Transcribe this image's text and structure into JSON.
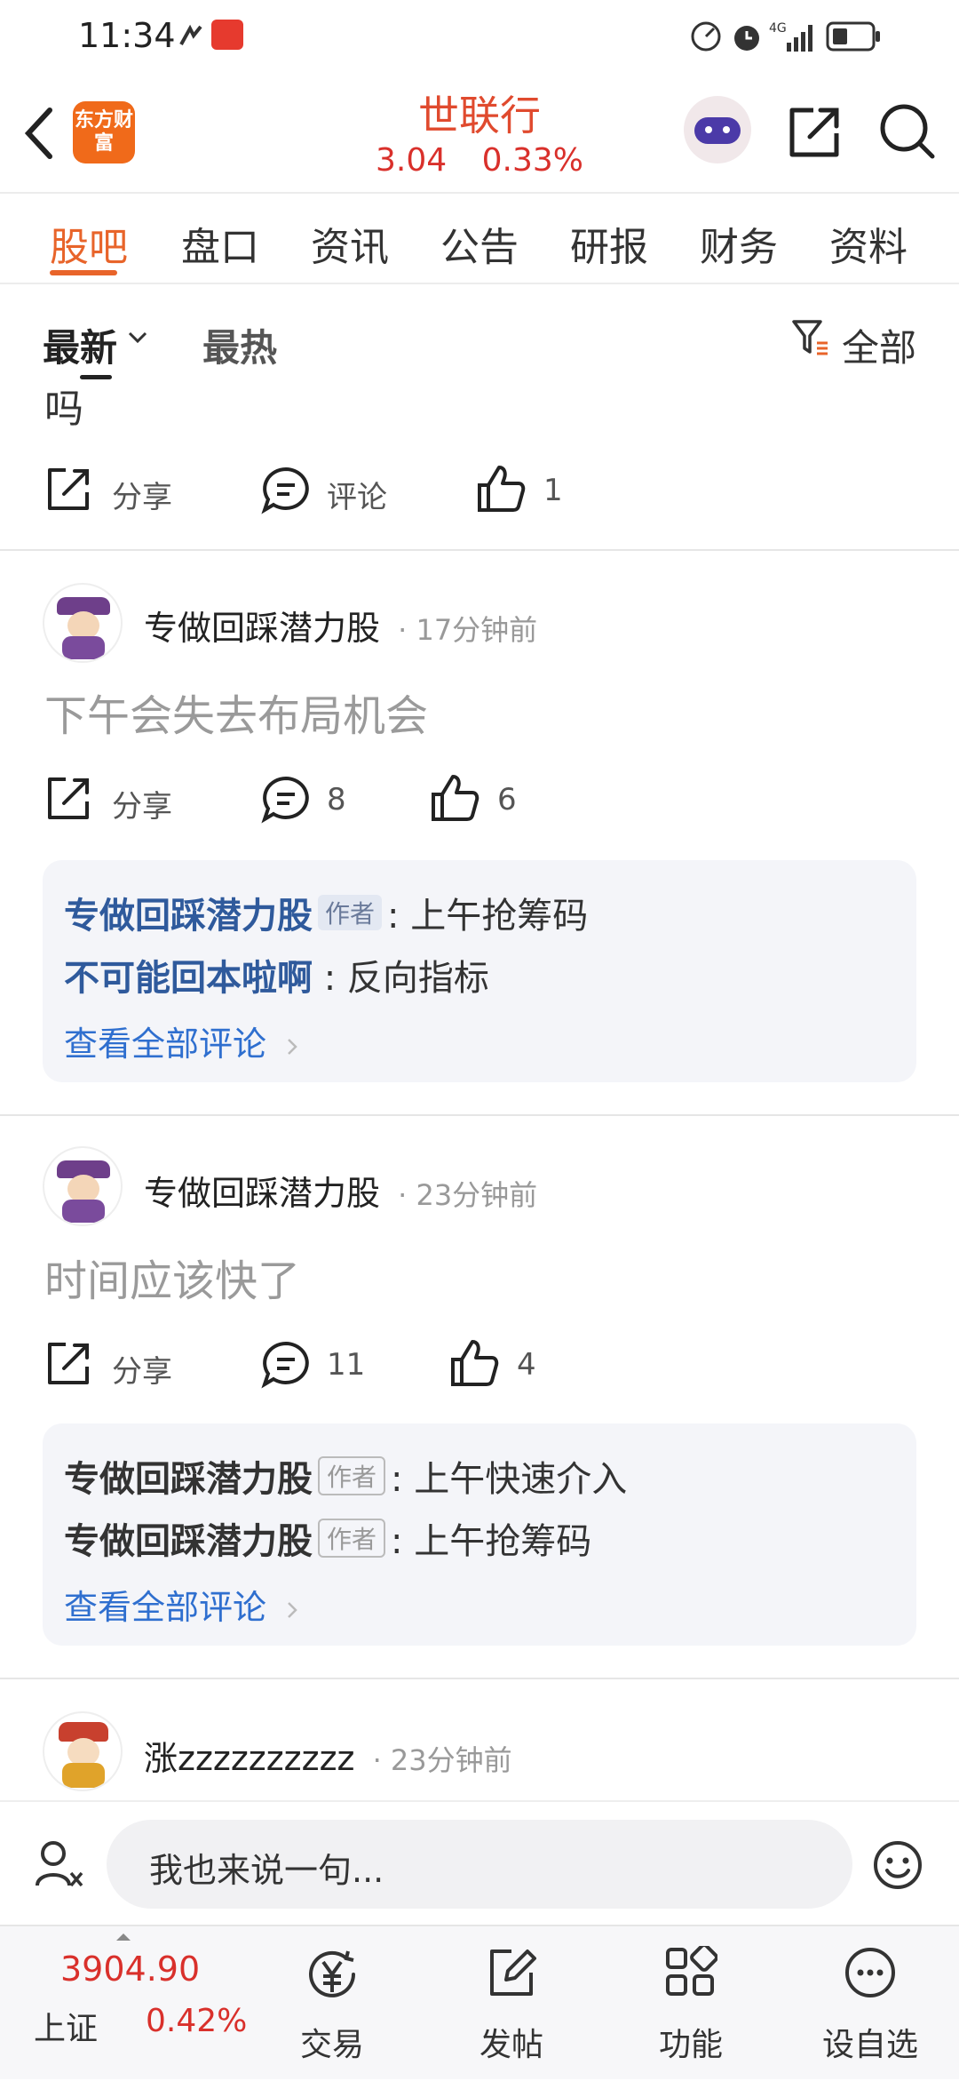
{
  "status_bar": {
    "time": "11:34"
  },
  "header": {
    "logo_text": "东方财富",
    "stock_name": "世联行",
    "price": "3.04",
    "change": "0.33%"
  },
  "tabs": [
    "股吧",
    "盘口",
    "资讯",
    "公告",
    "研报",
    "财务",
    "资料"
  ],
  "filters": {
    "latest": "最新",
    "hot": "最热",
    "all": "全部"
  },
  "partial_post": {
    "text": "吗",
    "share": "分享",
    "comment": "评论",
    "likes": "1"
  },
  "posts": [
    {
      "author": "专做回踩潜力股",
      "time": "· 17分钟前",
      "text": "下午会失去布局机会",
      "share": "分享",
      "comments": "8",
      "likes": "6",
      "replies": [
        {
          "name": "专做回踩潜力股",
          "badge": "作者",
          "text": ": 上午抢筹码"
        },
        {
          "name": "不可能回本啦啊",
          "badge": "",
          "text": ": 反向指标"
        }
      ],
      "see_all": "查看全部评论"
    },
    {
      "author": "专做回踩潜力股",
      "time": "· 23分钟前",
      "text": "时间应该快了",
      "share": "分享",
      "comments": "11",
      "likes": "4",
      "replies": [
        {
          "name": "专做回踩潜力股",
          "badge": "作者",
          "text": ": 上午快速介入"
        },
        {
          "name": "专做回踩潜力股",
          "badge": "作者",
          "text": ": 上午抢筹码"
        }
      ],
      "see_all": "查看全部评论"
    },
    {
      "author": "涨zzzzzzzzzz",
      "time": "· 23分钟前"
    }
  ],
  "comment_input": {
    "placeholder": "我也来说一句..."
  },
  "bottom_nav": {
    "index_value": "3904.90",
    "index_name": "上证",
    "index_change": "0.42%",
    "trade": "交易",
    "post": "发帖",
    "functions": "功能",
    "watchlist": "设自选"
  },
  "colors": {
    "accent": "#e8642a",
    "price_red": "#d9302b",
    "link_blue": "#2f6fcf"
  }
}
